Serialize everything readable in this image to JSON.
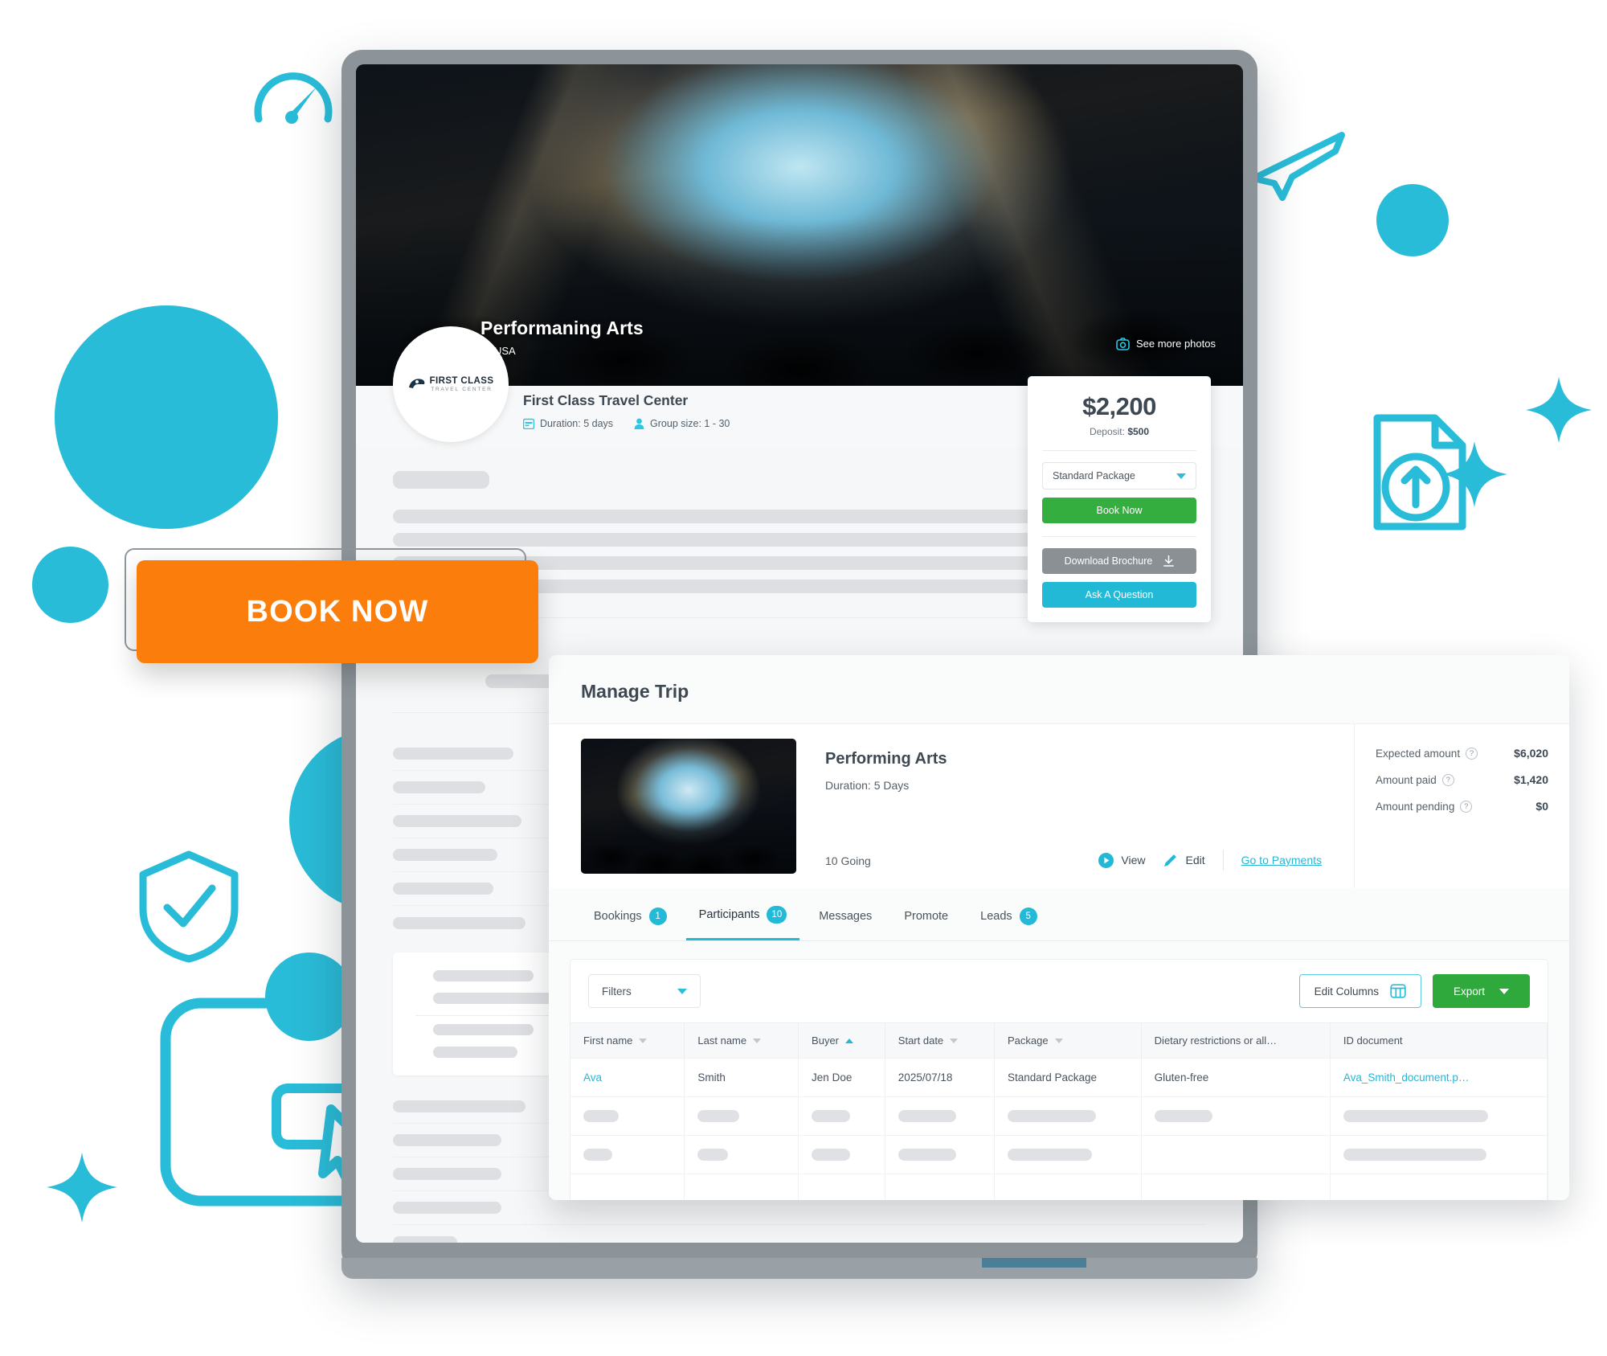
{
  "hero": {
    "title": "Performaning Arts",
    "location": "USA",
    "location_icon": "map-pin-icon",
    "see_more_photos": "See more photos",
    "camera_icon": "camera-icon"
  },
  "operator": {
    "name": "First Class Travel Center",
    "logo_line1": "FIRST CLASS",
    "logo_line2": "TRAVEL CENTER",
    "duration": "Duration: 5 days",
    "duration_icon": "calendar-icon",
    "group_size": "Group size: 1 - 30",
    "group_icon": "person-icon"
  },
  "price_card": {
    "price": "$2,200",
    "deposit_label": "Deposit:",
    "deposit_value": "$500",
    "package_selected": "Standard Package",
    "book_now": "Book Now",
    "download_brochure": "Download Brochure",
    "download_icon": "download-icon",
    "ask_question": "Ask A Question",
    "colors": {
      "book": "#33ae3f",
      "download": "#8b9095",
      "ask": "#21b9d6"
    }
  },
  "floating_cta": {
    "label": "BOOK NOW",
    "color": "#fb7e0c"
  },
  "manage": {
    "title": "Manage Trip",
    "trip": {
      "name": "Performing Arts",
      "duration": "Duration: 5 Days",
      "going": "10 Going",
      "view": "View",
      "view_icon": "play-circle-icon",
      "edit": "Edit",
      "edit_icon": "pencil-icon",
      "payments_link": "Go to Payments"
    },
    "amounts": [
      {
        "label": "Expected amount",
        "value": "$6,020",
        "help_icon": "help-icon"
      },
      {
        "label": "Amount paid",
        "value": "$1,420",
        "help_icon": "help-icon"
      },
      {
        "label": "Amount pending",
        "value": "$0",
        "help_icon": "help-icon"
      }
    ],
    "tabs": [
      {
        "label": "Bookings",
        "badge": "1",
        "active": false
      },
      {
        "label": "Participants",
        "badge": "10",
        "active": true
      },
      {
        "label": "Messages",
        "badge": "",
        "active": false
      },
      {
        "label": "Promote",
        "badge": "",
        "active": false
      },
      {
        "label": "Leads",
        "badge": "5",
        "active": false
      }
    ],
    "toolbar": {
      "filters": "Filters",
      "edit_columns": "Edit Columns",
      "columns_icon": "columns-icon",
      "export": "Export",
      "export_color": "#2fa83c"
    },
    "table": {
      "columns": [
        {
          "label": "First name",
          "sort": "down"
        },
        {
          "label": "Last name",
          "sort": "down"
        },
        {
          "label": "Buyer",
          "sort": "up"
        },
        {
          "label": "Start date",
          "sort": "down"
        },
        {
          "label": "Package",
          "sort": "down"
        },
        {
          "label": "Dietary restrictions or all…",
          "sort": "none"
        },
        {
          "label": "ID document",
          "sort": "none"
        }
      ],
      "rows": [
        {
          "first_name": "Ava",
          "last_name": "Smith",
          "buyer": "Jen Doe",
          "start_date": "2025/07/18",
          "package": "Standard Package",
          "dietary": "Gluten-free",
          "id_document": "Ava_Smith_document.p…"
        }
      ]
    }
  },
  "decorations": {
    "gauge_icon": "speedometer-icon",
    "plane_icon": "airplane-icon",
    "upload_doc_icon": "document-upload-icon",
    "shield_icon": "shield-check-icon",
    "cursor_icon": "click-cursor-icon",
    "sparkle_icon": "sparkle-icon",
    "accent_color": "#29bcd8"
  }
}
